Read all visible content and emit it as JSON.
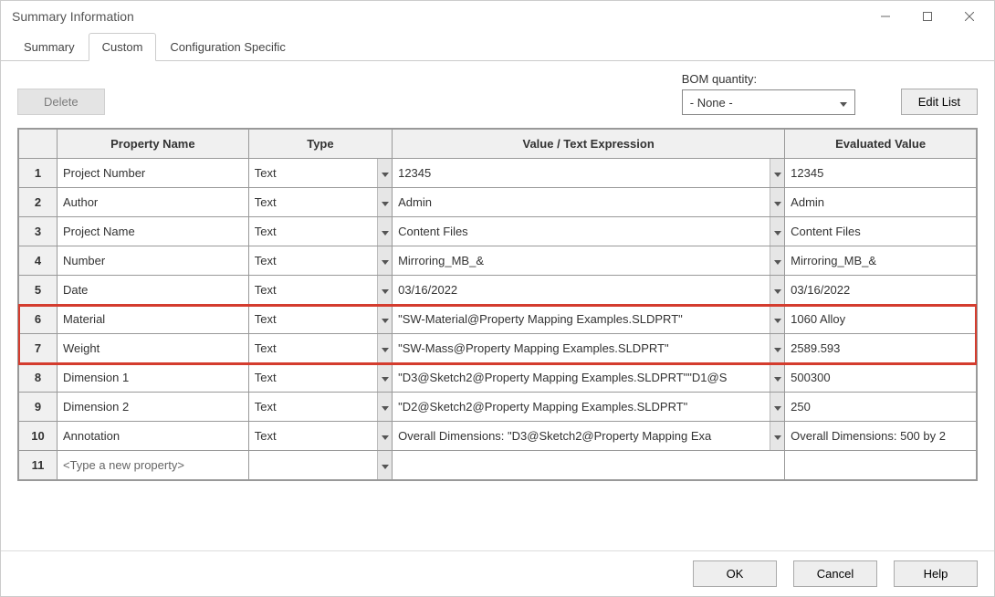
{
  "window": {
    "title": "Summary Information"
  },
  "tabs": [
    {
      "label": "Summary",
      "active": false
    },
    {
      "label": "Custom",
      "active": true
    },
    {
      "label": "Configuration Specific",
      "active": false
    }
  ],
  "buttons": {
    "delete": "Delete",
    "edit_list": "Edit List",
    "ok": "OK",
    "cancel": "Cancel",
    "help": "Help"
  },
  "bom": {
    "label": "BOM quantity:",
    "value": "- None -"
  },
  "table": {
    "headers": {
      "propname": "Property Name",
      "type": "Type",
      "valexpr": "Value / Text Expression",
      "evalval": "Evaluated Value"
    },
    "rows": [
      {
        "n": "1",
        "name": "Project Number",
        "type": "Text",
        "val": "12345",
        "eval": "12345"
      },
      {
        "n": "2",
        "name": "Author",
        "type": "Text",
        "val": "Admin",
        "eval": "Admin"
      },
      {
        "n": "3",
        "name": "Project Name",
        "type": "Text",
        "val": "Content Files",
        "eval": "Content Files"
      },
      {
        "n": "4",
        "name": "Number",
        "type": "Text",
        "val": "Mirroring_MB_&",
        "eval": "Mirroring_MB_&"
      },
      {
        "n": "5",
        "name": "Date",
        "type": "Text",
        "val": "03/16/2022",
        "eval": "03/16/2022"
      },
      {
        "n": "6",
        "name": "Material",
        "type": "Text",
        "val": "\"SW-Material@Property Mapping Examples.SLDPRT\"",
        "eval": "1060 Alloy"
      },
      {
        "n": "7",
        "name": "Weight",
        "type": "Text",
        "val": "\"SW-Mass@Property Mapping Examples.SLDPRT\"",
        "eval": "2589.593"
      },
      {
        "n": "8",
        "name": "Dimension 1",
        "type": "Text",
        "val": "\"D3@Sketch2@Property Mapping Examples.SLDPRT\"\"D1@S",
        "eval": "500300"
      },
      {
        "n": "9",
        "name": "Dimension 2",
        "type": "Text",
        "val": "\"D2@Sketch2@Property Mapping Examples.SLDPRT\"",
        "eval": "250"
      },
      {
        "n": "10",
        "name": "Annotation",
        "type": "Text",
        "val": "Overall Dimensions: \"D3@Sketch2@Property Mapping Exa",
        "eval": "Overall Dimensions: 500 by 2"
      }
    ],
    "new_row": {
      "n": "11",
      "placeholder": "<Type a new property>"
    }
  },
  "highlight": {
    "rows": [
      6,
      7
    ]
  }
}
